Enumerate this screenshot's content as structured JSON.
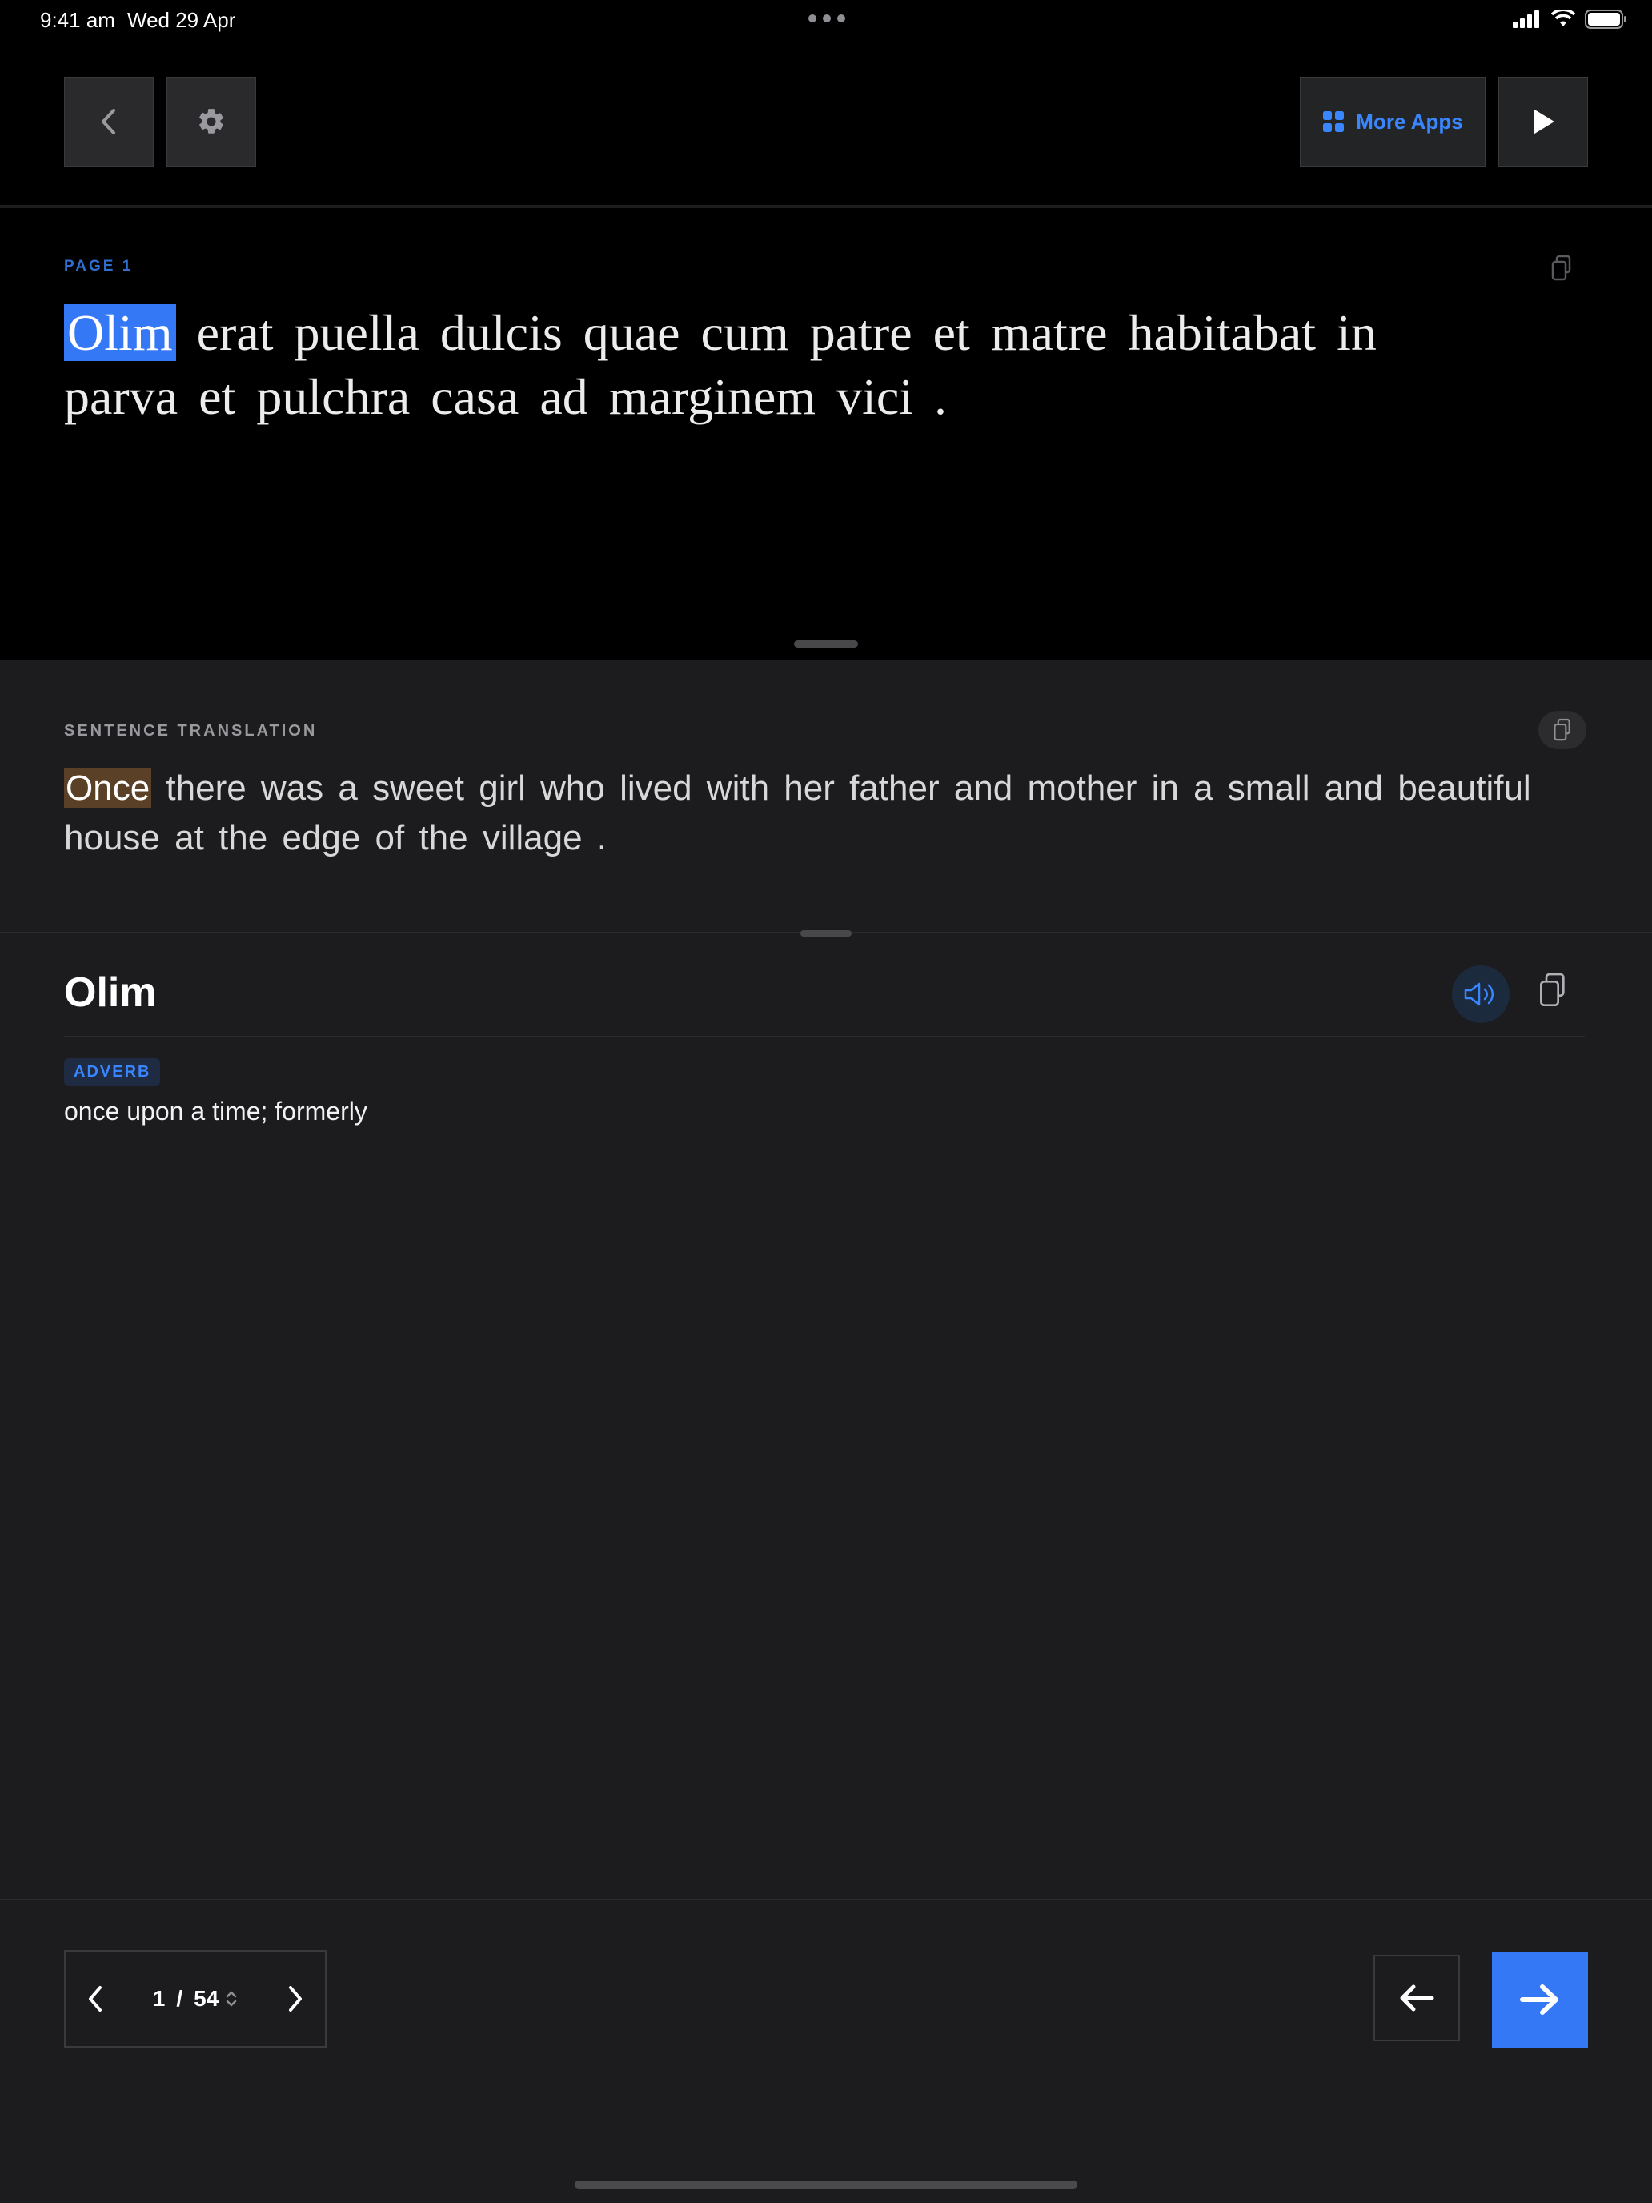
{
  "status_bar": {
    "time": "9:41 am",
    "date": "Wed 29 Apr",
    "icons": [
      "signal-icon",
      "wifi-icon",
      "battery-icon"
    ]
  },
  "toolbar": {
    "back_icon": "chevron-left-icon",
    "settings_icon": "gear-icon",
    "more_apps_label": "More Apps",
    "more_apps_icon": "grid-icon",
    "play_icon": "play-icon"
  },
  "reader": {
    "page_label": "PAGE 1",
    "highlighted_word": "Olim",
    "text_rest": " erat puella dulcis quae cum patre et matre habitabat in parva et pulchra casa ad marginem vici ."
  },
  "translation": {
    "label": "SENTENCE TRANSLATION",
    "highlighted_word": "Once",
    "text_rest": " there was a sweet girl who lived with her father and mother in a small and beautiful house at the edge of the village ."
  },
  "definition": {
    "word": "Olim",
    "part_of_speech": "ADVERB",
    "meaning": "once upon a time; formerly"
  },
  "pager": {
    "current": "1",
    "separator": "/",
    "total": "54"
  },
  "colors": {
    "accent": "#3478f6",
    "word_highlight": "#3478f6",
    "translation_highlight": "#5a4026",
    "background_top": "#000000",
    "background_panel": "#1c1c1e"
  }
}
